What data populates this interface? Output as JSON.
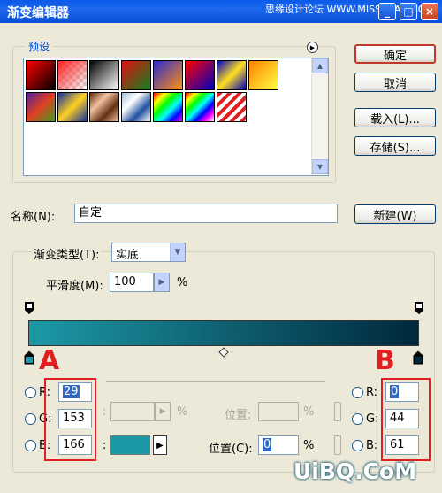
{
  "window": {
    "title": "渐变编辑器",
    "watermark_top": "思缘设计论坛 WWW.MISSYUAN.COM",
    "buttons": {
      "minimize": "_",
      "maximize": "□",
      "close": "×"
    }
  },
  "presets": {
    "label": "预设",
    "menu_icon": "play-arrow-icon"
  },
  "buttons": {
    "ok": "确定",
    "cancel": "取消",
    "load": "载入(L)...",
    "save": "存储(S)...",
    "new": "新建(W)"
  },
  "name": {
    "label": "名称(N):",
    "value": "自定"
  },
  "gradient": {
    "type_label": "渐变类型(T):",
    "type_value": "实底",
    "smoothness_label": "平滑度(M):",
    "smoothness_value": "100",
    "percent": "%",
    "start_color": "#1d99a6",
    "end_color": "#00283d"
  },
  "annotations": {
    "a": "A",
    "b": "B"
  },
  "color_left": {
    "r_label": "R:",
    "r_value": "29",
    "g_label": "G:",
    "g_value": "153",
    "b_label": "B:",
    "b_value": "166"
  },
  "color_right": {
    "r_label": "R:",
    "r_value": "0",
    "g_label": "G:",
    "g_value": "44",
    "b_label": "B:",
    "b_value": "61"
  },
  "stops": {
    "opacity_position_label": "位置:",
    "position_label": "位置(C):",
    "position_value": "0",
    "percent": "%",
    "colon": ":"
  },
  "watermark_bottom": "UiBQ.CoM"
}
